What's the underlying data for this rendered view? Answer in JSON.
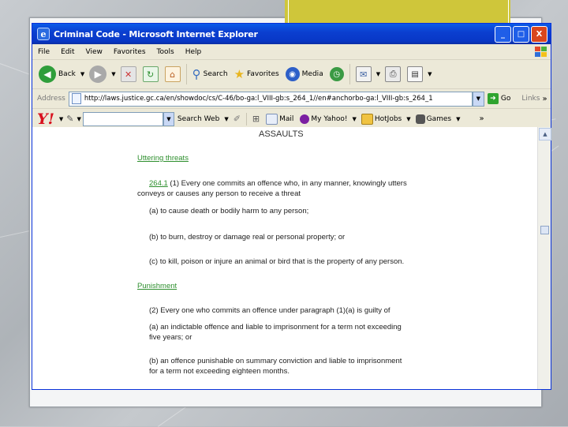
{
  "window": {
    "title": "Criminal Code - Microsoft Internet Explorer",
    "buttons": {
      "minimize": "_",
      "maximize": "□",
      "close": "X"
    }
  },
  "menu": [
    "File",
    "Edit",
    "View",
    "Favorites",
    "Tools",
    "Help"
  ],
  "toolbar": {
    "back": "Back",
    "search": "Search",
    "favorites": "Favorites",
    "media": "Media"
  },
  "address": {
    "label": "Address",
    "url": "http://laws.justice.gc.ca/en/showdoc/cs/C-46/bo-ga:l_VIII-gb:s_264_1//en#anchorbo-ga:l_VIII-gb:s_264_1",
    "go": "Go",
    "links": "Links",
    "chevron": "»"
  },
  "yahoo": {
    "logo": "Y!",
    "search_web": "Search Web",
    "mail": "Mail",
    "my_yahoo": "My Yahoo!",
    "hotjobs": "HotJobs",
    "games": "Games",
    "chevron": "»"
  },
  "document": {
    "heading": "ASSAULTS",
    "link1": "Uttering threats",
    "section_number": "264.1",
    "para1_line1": "(1) Every one commits an offence who, in any manner, knowingly utters",
    "para1_line2": "conveys or causes any person to receive a threat",
    "item_a": "(a) to cause death or bodily harm to any person;",
    "item_b": "(b) to burn, destroy or damage real or personal property; or",
    "item_c": "(c) to kill, poison or injure an animal or bird that is the property of any person.",
    "link2": "Punishment",
    "para2": "(2) Every one who commits an offence under paragraph (1)(a) is guilty of",
    "item2a_line1": "(a) an indictable offence and liable to imprisonment for a term not exceeding",
    "item2a_line2": "five years; or",
    "item2b_line1": "(b) an offence punishable on summary conviction and liable to imprisonment",
    "item2b_line2": "for a term not exceeding eighteen months."
  }
}
